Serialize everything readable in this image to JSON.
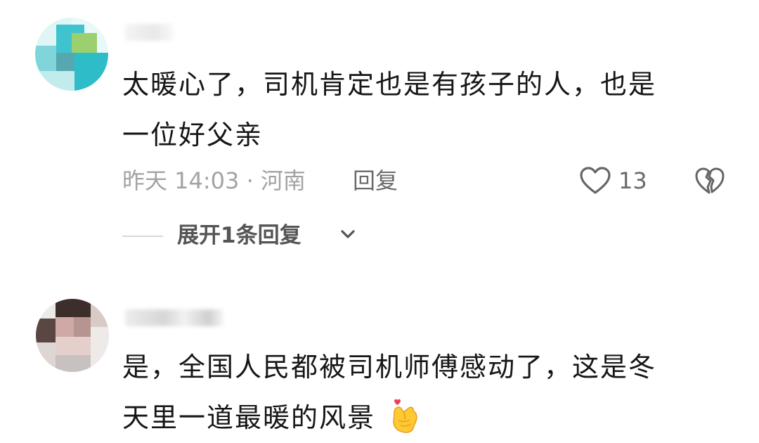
{
  "comments": [
    {
      "text_line1": "太暖心了，司机肯定也是有孩子的人，也是",
      "text_line2": "一位好父亲",
      "meta": "昨天 14:03 · 河南",
      "reply_label": "回复",
      "likes": "13",
      "expand_replies_label": "展开1条回复"
    },
    {
      "text_line1": "是，全国人民都被司机师傅感动了，这是冬",
      "text_line2": "天里一道最暖的风景"
    }
  ],
  "icons": {
    "like": "heart-outline-icon",
    "dislike": "broken-heart-icon",
    "expand": "chevron-down-icon",
    "emoji": "finger-heart-emoji"
  },
  "colors": {
    "text": "#161616",
    "meta": "#a3a3a3",
    "action": "#6a6a6a",
    "divider": "#d9d9d9"
  }
}
